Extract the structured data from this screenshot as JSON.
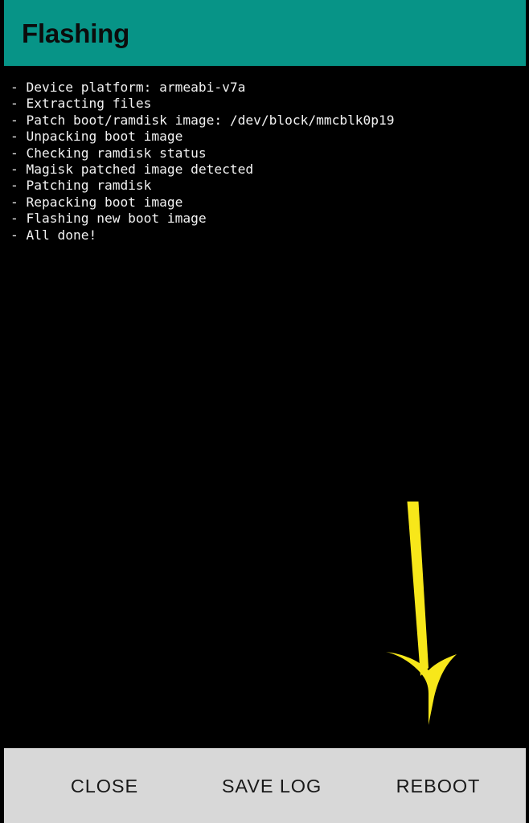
{
  "app_bar": {
    "title": "Flashing",
    "background_color": "#079487",
    "title_color": "#0c0c0c"
  },
  "console": {
    "background_color": "#000000",
    "text_color": "#f2f2f2",
    "lines": [
      "- Device platform: armeabi-v7a",
      "- Extracting files",
      "- Patch boot/ramdisk image: /dev/block/mmcblk0p19",
      "- Unpacking boot image",
      "- Checking ramdisk status",
      "- Magisk patched image detected",
      "- Patching ramdisk",
      "- Repacking boot image",
      "- Flashing new boot image",
      "- All done!"
    ]
  },
  "annotation": {
    "icon": "down-arrow-icon",
    "color": "#f7e71a",
    "points_to": "REBOOT"
  },
  "button_bar": {
    "background_color": "#d8d8d8",
    "buttons": [
      {
        "label": "CLOSE"
      },
      {
        "label": "SAVE LOG"
      },
      {
        "label": "REBOOT"
      }
    ]
  }
}
